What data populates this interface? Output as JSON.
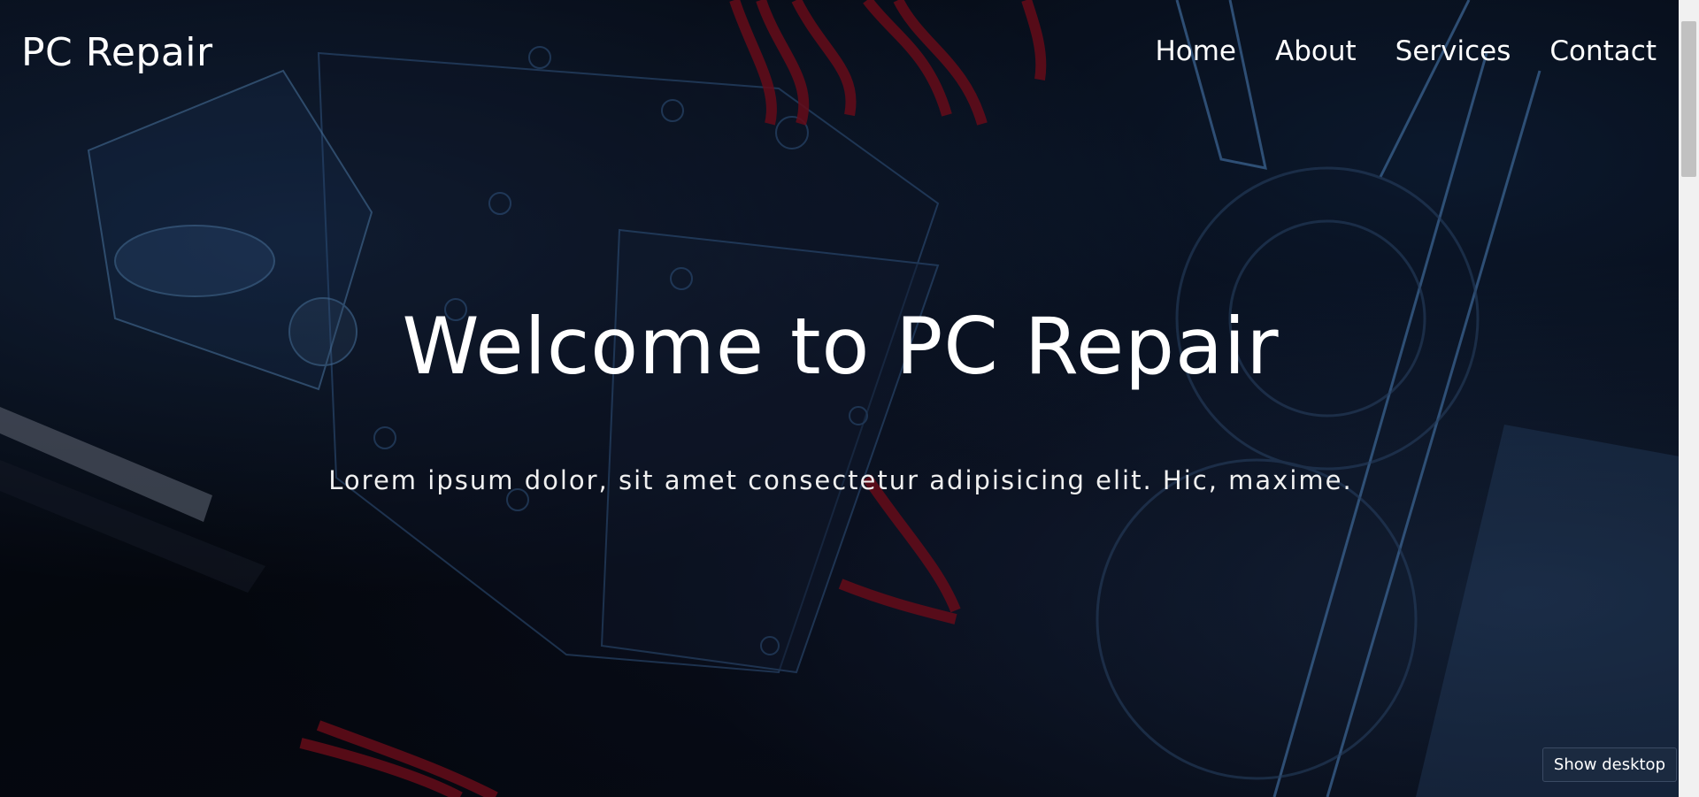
{
  "brand": {
    "name": "PC Repair"
  },
  "nav": {
    "items": [
      {
        "label": "Home"
      },
      {
        "label": "About"
      },
      {
        "label": "Services"
      },
      {
        "label": "Contact"
      }
    ]
  },
  "hero": {
    "title": "Welcome to PC Repair",
    "subtitle": "Lorem ipsum dolor, sit amet consectetur adipisicing elit. Hic, maxime."
  },
  "taskbar_tooltip": {
    "label": "Show desktop"
  },
  "colors": {
    "text": "#ffffff",
    "background": "#05070d",
    "accent_blue": "#3a7bd5",
    "cable_red": "#b3122a"
  }
}
